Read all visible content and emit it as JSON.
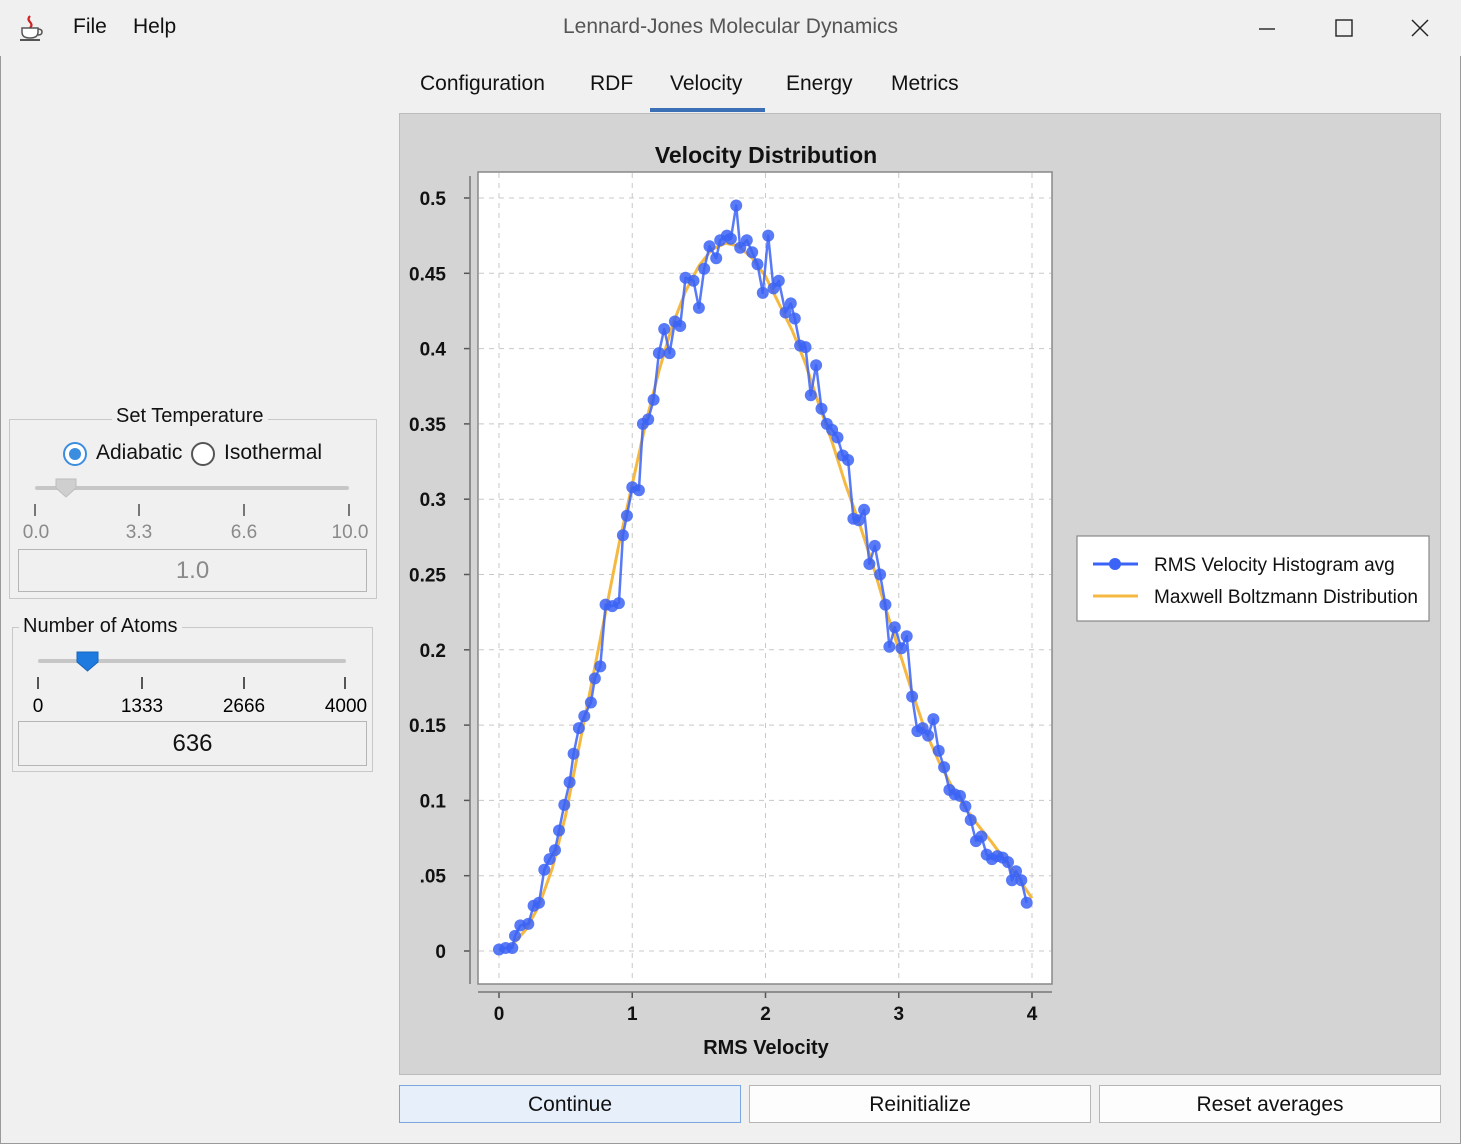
{
  "window": {
    "title": "Lennard-Jones Molecular Dynamics"
  },
  "menu": {
    "items": [
      "File",
      "Help"
    ]
  },
  "tabs": [
    {
      "label": "Configuration"
    },
    {
      "label": "RDF"
    },
    {
      "label": "Velocity",
      "active": true
    },
    {
      "label": "Energy"
    },
    {
      "label": "Metrics"
    }
  ],
  "temperature": {
    "title": "Set Temperature",
    "modes": [
      {
        "label": "Adiabatic",
        "checked": true
      },
      {
        "label": "Isothermal",
        "checked": false
      }
    ],
    "slider": {
      "min": 0.0,
      "max": 10.0,
      "value": 1.0,
      "ticks": [
        "0.0",
        "3.3",
        "6.6",
        "10.0"
      ]
    },
    "value": "1.0"
  },
  "atoms": {
    "title": "Number of Atoms",
    "slider": {
      "min": 0,
      "max": 4000,
      "value": 636,
      "ticks": [
        "0",
        "1333",
        "2666",
        "4000"
      ]
    },
    "value": "636"
  },
  "buttons": {
    "continue": "Continue",
    "reinitialize": "Reinitialize",
    "reset": "Reset averages"
  },
  "icons": {
    "app": "java-cup-icon",
    "minimize": "minimize-icon",
    "maximize": "maximize-icon",
    "close": "close-icon"
  },
  "colors": {
    "histogram": "#3b63f5",
    "maxwell": "#f5b942",
    "tab_accent": "#3b6fb6"
  },
  "chart_data": {
    "type": "line",
    "title": "Velocity Distribution",
    "xlabel": "RMS Velocity",
    "ylabel": "",
    "xlim": [
      0,
      4
    ],
    "ylim": [
      0,
      0.5
    ],
    "x_ticks": [
      "0",
      "1",
      "2",
      "3",
      "4"
    ],
    "y_ticks": [
      "0",
      ".05",
      "0.1",
      "0.15",
      "0.2",
      "0.25",
      "0.3",
      "0.35",
      "0.4",
      "0.45",
      "0.5"
    ],
    "grid": true,
    "legend_position": "right",
    "series": [
      {
        "name": "RMS Velocity Histogram avg",
        "style": "line-markers",
        "points": [
          [
            0.0,
            0.001
          ],
          [
            0.05,
            0.002
          ],
          [
            0.1,
            0.002
          ],
          [
            0.12,
            0.01
          ],
          [
            0.16,
            0.017
          ],
          [
            0.22,
            0.018
          ],
          [
            0.26,
            0.03
          ],
          [
            0.3,
            0.032
          ],
          [
            0.34,
            0.054
          ],
          [
            0.38,
            0.061
          ],
          [
            0.42,
            0.067
          ],
          [
            0.45,
            0.08
          ],
          [
            0.49,
            0.097
          ],
          [
            0.53,
            0.112
          ],
          [
            0.56,
            0.131
          ],
          [
            0.6,
            0.148
          ],
          [
            0.64,
            0.156
          ],
          [
            0.69,
            0.165
          ],
          [
            0.72,
            0.181
          ],
          [
            0.76,
            0.189
          ],
          [
            0.8,
            0.23
          ],
          [
            0.85,
            0.229
          ],
          [
            0.9,
            0.231
          ],
          [
            0.93,
            0.276
          ],
          [
            0.96,
            0.289
          ],
          [
            1.0,
            0.308
          ],
          [
            1.05,
            0.306
          ],
          [
            1.08,
            0.35
          ],
          [
            1.12,
            0.353
          ],
          [
            1.16,
            0.366
          ],
          [
            1.2,
            0.397
          ],
          [
            1.24,
            0.413
          ],
          [
            1.28,
            0.397
          ],
          [
            1.32,
            0.418
          ],
          [
            1.36,
            0.415
          ],
          [
            1.4,
            0.447
          ],
          [
            1.46,
            0.445
          ],
          [
            1.5,
            0.427
          ],
          [
            1.54,
            0.453
          ],
          [
            1.58,
            0.468
          ],
          [
            1.63,
            0.46
          ],
          [
            1.66,
            0.472
          ],
          [
            1.71,
            0.475
          ],
          [
            1.74,
            0.473
          ],
          [
            1.78,
            0.495
          ],
          [
            1.81,
            0.467
          ],
          [
            1.86,
            0.472
          ],
          [
            1.9,
            0.464
          ],
          [
            1.94,
            0.456
          ],
          [
            1.98,
            0.437
          ],
          [
            2.02,
            0.475
          ],
          [
            2.06,
            0.44
          ],
          [
            2.1,
            0.445
          ],
          [
            2.15,
            0.424
          ],
          [
            2.19,
            0.43
          ],
          [
            2.22,
            0.42
          ],
          [
            2.26,
            0.402
          ],
          [
            2.3,
            0.401
          ],
          [
            2.34,
            0.369
          ],
          [
            2.38,
            0.389
          ],
          [
            2.42,
            0.36
          ],
          [
            2.46,
            0.35
          ],
          [
            2.5,
            0.346
          ],
          [
            2.54,
            0.341
          ],
          [
            2.58,
            0.329
          ],
          [
            2.62,
            0.326
          ],
          [
            2.66,
            0.287
          ],
          [
            2.7,
            0.286
          ],
          [
            2.74,
            0.293
          ],
          [
            2.78,
            0.257
          ],
          [
            2.82,
            0.269
          ],
          [
            2.86,
            0.25
          ],
          [
            2.9,
            0.23
          ],
          [
            2.93,
            0.202
          ],
          [
            2.97,
            0.215
          ],
          [
            3.02,
            0.201
          ],
          [
            3.06,
            0.209
          ],
          [
            3.1,
            0.169
          ],
          [
            3.14,
            0.146
          ],
          [
            3.18,
            0.148
          ],
          [
            3.22,
            0.143
          ],
          [
            3.26,
            0.154
          ],
          [
            3.3,
            0.133
          ],
          [
            3.34,
            0.122
          ],
          [
            3.38,
            0.107
          ],
          [
            3.42,
            0.104
          ],
          [
            3.46,
            0.103
          ],
          [
            3.5,
            0.096
          ],
          [
            3.54,
            0.087
          ],
          [
            3.58,
            0.073
          ],
          [
            3.62,
            0.076
          ],
          [
            3.66,
            0.064
          ],
          [
            3.7,
            0.061
          ],
          [
            3.74,
            0.063
          ],
          [
            3.78,
            0.062
          ],
          [
            3.82,
            0.059
          ],
          [
            3.85,
            0.047
          ],
          [
            3.88,
            0.053
          ],
          [
            3.92,
            0.047
          ],
          [
            3.96,
            0.032
          ]
        ]
      },
      {
        "name": "Maxwell Boltzmann Distribution",
        "style": "line",
        "points": [
          [
            0.0,
            0.0
          ],
          [
            0.1,
            0.004
          ],
          [
            0.2,
            0.014
          ],
          [
            0.3,
            0.03
          ],
          [
            0.4,
            0.055
          ],
          [
            0.5,
            0.09
          ],
          [
            0.6,
            0.135
          ],
          [
            0.7,
            0.18
          ],
          [
            0.8,
            0.225
          ],
          [
            0.9,
            0.27
          ],
          [
            1.0,
            0.31
          ],
          [
            1.1,
            0.35
          ],
          [
            1.2,
            0.385
          ],
          [
            1.3,
            0.415
          ],
          [
            1.4,
            0.438
          ],
          [
            1.5,
            0.455
          ],
          [
            1.6,
            0.466
          ],
          [
            1.7,
            0.47
          ],
          [
            1.8,
            0.468
          ],
          [
            1.9,
            0.46
          ],
          [
            2.0,
            0.448
          ],
          [
            2.1,
            0.43
          ],
          [
            2.2,
            0.412
          ],
          [
            2.3,
            0.39
          ],
          [
            2.4,
            0.363
          ],
          [
            2.5,
            0.338
          ],
          [
            2.6,
            0.31
          ],
          [
            2.7,
            0.285
          ],
          [
            2.8,
            0.258
          ],
          [
            2.9,
            0.228
          ],
          [
            3.0,
            0.2
          ],
          [
            3.1,
            0.172
          ],
          [
            3.2,
            0.146
          ],
          [
            3.3,
            0.126
          ],
          [
            3.4,
            0.109
          ],
          [
            3.5,
            0.095
          ],
          [
            3.6,
            0.083
          ],
          [
            3.7,
            0.072
          ],
          [
            3.8,
            0.06
          ],
          [
            3.9,
            0.048
          ],
          [
            4.0,
            0.035
          ]
        ]
      }
    ]
  }
}
